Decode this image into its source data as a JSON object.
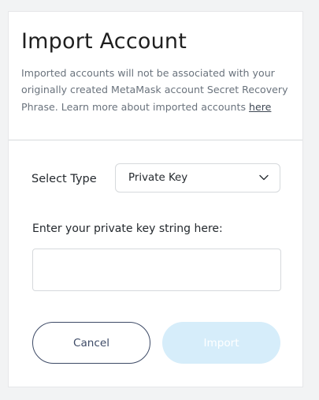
{
  "header": {
    "title": "Import Account",
    "description": "Imported accounts will not be associated with your originally created MetaMask account Secret Recovery Phrase. Learn more about imported accounts ",
    "link_text": "here"
  },
  "select_type": {
    "label": "Select Type",
    "selected": "Private Key",
    "icon": "chevron-down-icon"
  },
  "private_key": {
    "label": "Enter your private key string here:",
    "value": "",
    "placeholder": ""
  },
  "actions": {
    "cancel_label": "Cancel",
    "import_label": "Import",
    "import_disabled": true
  },
  "colors": {
    "primary_text": "#24292e",
    "secondary_text": "#6a737d",
    "cancel_border": "#3d4a66",
    "import_disabled_bg": "#d6edfa",
    "border": "#d6d9dc"
  }
}
